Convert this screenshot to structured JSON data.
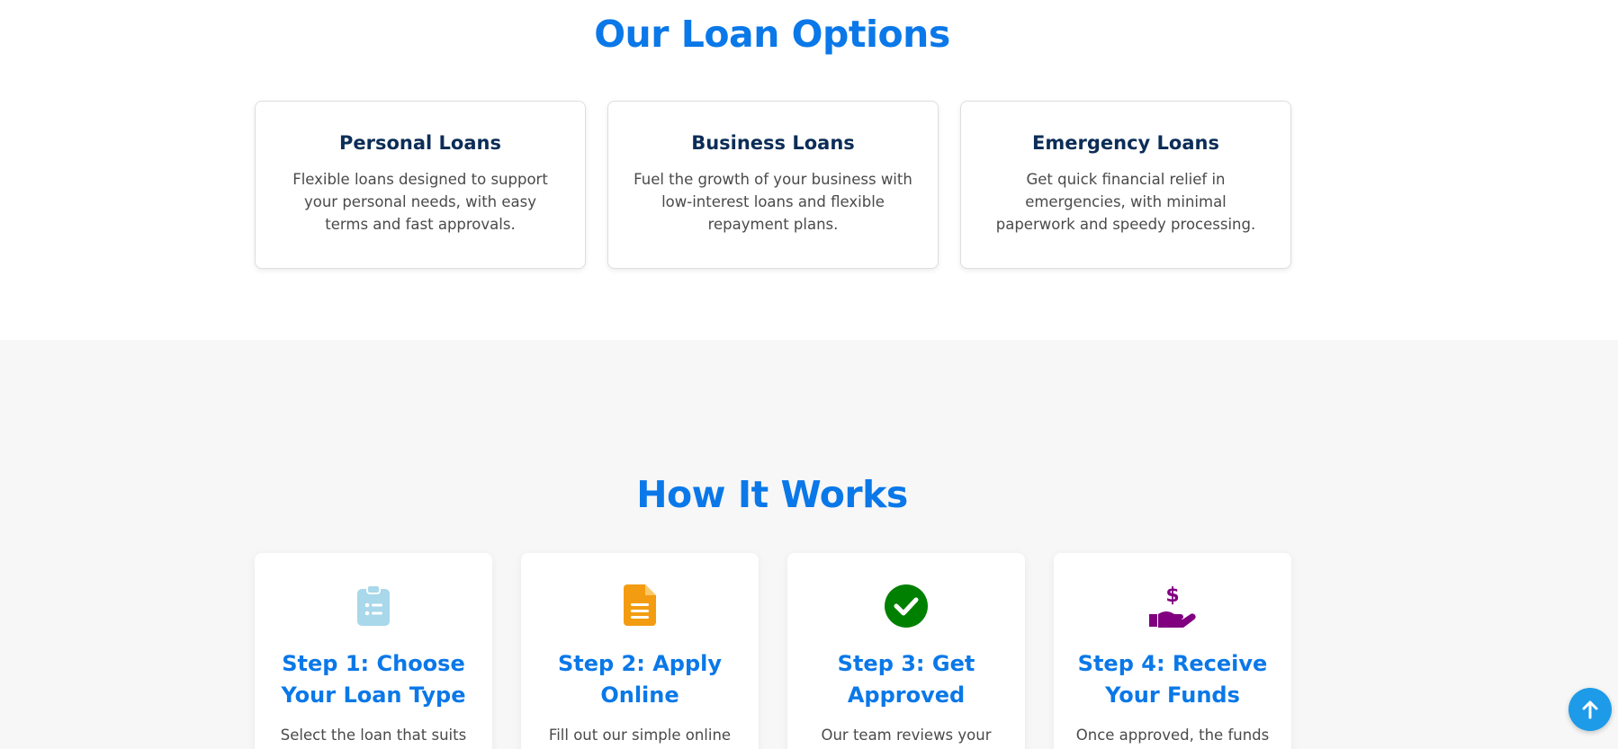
{
  "loans": {
    "title": "Our Loan Options",
    "cards": [
      {
        "title": "Personal Loans",
        "text": "Flexible loans designed to support your personal needs, with easy terms and fast approvals."
      },
      {
        "title": "Business Loans",
        "text": "Fuel the growth of your business with low-interest loans and flexible repayment plans."
      },
      {
        "title": "Emergency Loans",
        "text": "Get quick financial relief in emergencies, with minimal paperwork and speedy processing."
      }
    ]
  },
  "how": {
    "title": "How It Works",
    "steps": [
      {
        "title": "Step 1: Choose Your Loan Type",
        "text": "Select the loan that suits",
        "icon": "clipboard-list-icon",
        "color": "#a8d8ea"
      },
      {
        "title": "Step 2: Apply Online",
        "text": "Fill out our simple online",
        "icon": "file-lines-icon",
        "color": "#f39c12"
      },
      {
        "title": "Step 3: Get Approved",
        "text": "Our team reviews your",
        "icon": "check-circle-icon",
        "color": "#008000"
      },
      {
        "title": "Step 4: Receive Your Funds",
        "text": "Once approved, the funds",
        "icon": "hand-holding-dollar-icon",
        "color": "#800080"
      }
    ]
  },
  "scroll_top": {
    "icon": "arrow-up-icon",
    "color": "#1e9be8"
  }
}
